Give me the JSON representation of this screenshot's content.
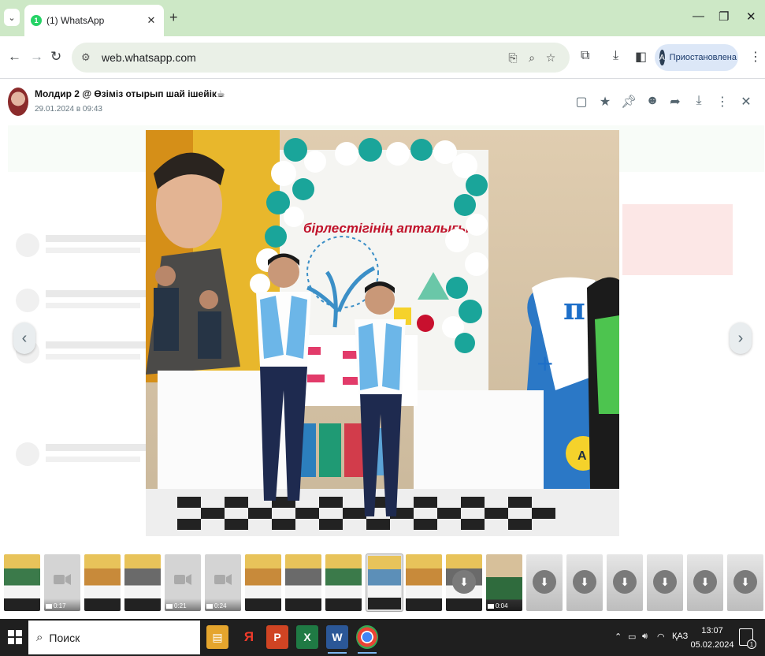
{
  "browser": {
    "tab": {
      "title": "(1) WhatsApp",
      "badge": "1"
    },
    "url": "web.whatsapp.com",
    "profile": {
      "initial": "A",
      "label": "Приостановлена"
    }
  },
  "viewer": {
    "sender": "Молдир 2 @ Өзіміз отырып шай ішейік☕",
    "timestamp": "29.01.2024 в 09:43",
    "photo_caption": "бірлестігінің апталығы",
    "thumbnails": [
      {
        "kind": "photo"
      },
      {
        "kind": "video",
        "duration": "0:17"
      },
      {
        "kind": "photo"
      },
      {
        "kind": "photo"
      },
      {
        "kind": "video",
        "duration": "0:21"
      },
      {
        "kind": "video",
        "duration": "0:24"
      },
      {
        "kind": "photo"
      },
      {
        "kind": "photo"
      },
      {
        "kind": "photo"
      },
      {
        "kind": "photo",
        "selected": true
      },
      {
        "kind": "photo"
      },
      {
        "kind": "photo-download"
      },
      {
        "kind": "video",
        "duration": "0:04"
      },
      {
        "kind": "download"
      },
      {
        "kind": "download"
      },
      {
        "kind": "download"
      },
      {
        "kind": "download"
      },
      {
        "kind": "download"
      },
      {
        "kind": "download"
      }
    ]
  },
  "taskbar": {
    "search_placeholder": "Поиск",
    "lang": "ҚАЗ",
    "time": "13:07",
    "date": "05.02.2024",
    "notifications": "1"
  }
}
